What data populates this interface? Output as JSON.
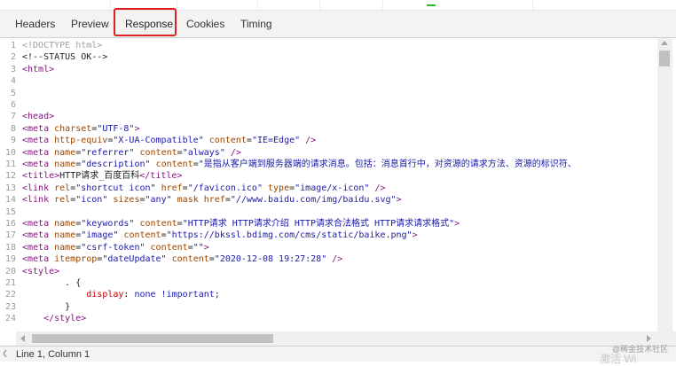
{
  "tabs": [
    {
      "label": "Headers"
    },
    {
      "label": "Preview"
    },
    {
      "label": "Response"
    },
    {
      "label": "Cookies"
    },
    {
      "label": "Timing"
    }
  ],
  "active_tab": "Response",
  "code_lines": [
    {
      "n": "1",
      "segs": [
        {
          "t": "<!DOCTYPE html>",
          "c": "comment"
        }
      ]
    },
    {
      "n": "2",
      "segs": [
        {
          "t": "<!--STATUS OK-->",
          "c": "text"
        }
      ]
    },
    {
      "n": "3",
      "segs": [
        {
          "t": "<html>",
          "c": "tag"
        }
      ]
    },
    {
      "n": "4",
      "segs": []
    },
    {
      "n": "5",
      "segs": []
    },
    {
      "n": "6",
      "segs": []
    },
    {
      "n": "7",
      "segs": [
        {
          "t": "<head>",
          "c": "tag"
        }
      ]
    },
    {
      "n": "8",
      "segs": [
        {
          "t": "<meta ",
          "c": "tag"
        },
        {
          "t": "charset",
          "c": "attr"
        },
        {
          "t": "=",
          "c": "text"
        },
        {
          "t": "\"UTF-8\"",
          "c": "val"
        },
        {
          "t": ">",
          "c": "tag"
        }
      ]
    },
    {
      "n": "9",
      "segs": [
        {
          "t": "<meta ",
          "c": "tag"
        },
        {
          "t": "http-equiv",
          "c": "attr"
        },
        {
          "t": "=",
          "c": "text"
        },
        {
          "t": "\"X-UA-Compatible\"",
          "c": "val"
        },
        {
          "t": " ",
          "c": "text"
        },
        {
          "t": "content",
          "c": "attr"
        },
        {
          "t": "=",
          "c": "text"
        },
        {
          "t": "\"IE=Edge\"",
          "c": "val"
        },
        {
          "t": " />",
          "c": "tag"
        }
      ]
    },
    {
      "n": "10",
      "segs": [
        {
          "t": "<meta ",
          "c": "tag"
        },
        {
          "t": "name",
          "c": "attr"
        },
        {
          "t": "=",
          "c": "text"
        },
        {
          "t": "\"referrer\"",
          "c": "val"
        },
        {
          "t": " ",
          "c": "text"
        },
        {
          "t": "content",
          "c": "attr"
        },
        {
          "t": "=",
          "c": "text"
        },
        {
          "t": "\"always\"",
          "c": "val"
        },
        {
          "t": " />",
          "c": "tag"
        }
      ]
    },
    {
      "n": "11",
      "segs": [
        {
          "t": "<meta ",
          "c": "tag"
        },
        {
          "t": "name",
          "c": "attr"
        },
        {
          "t": "=",
          "c": "text"
        },
        {
          "t": "\"description\"",
          "c": "val"
        },
        {
          "t": " ",
          "c": "text"
        },
        {
          "t": "content",
          "c": "attr"
        },
        {
          "t": "=",
          "c": "text"
        },
        {
          "t": "\"是指从客户端到服务器端的请求消息。包括：消息首行中，对资源的请求方法、资源的标识符、",
          "c": "val"
        }
      ]
    },
    {
      "n": "12",
      "segs": [
        {
          "t": "<title>",
          "c": "tag"
        },
        {
          "t": "HTTP请求_百度百科",
          "c": "text"
        },
        {
          "t": "</title>",
          "c": "tag"
        }
      ]
    },
    {
      "n": "13",
      "segs": [
        {
          "t": "<link ",
          "c": "tag"
        },
        {
          "t": "rel",
          "c": "attr"
        },
        {
          "t": "=",
          "c": "text"
        },
        {
          "t": "\"shortcut icon\"",
          "c": "val"
        },
        {
          "t": " ",
          "c": "text"
        },
        {
          "t": "href",
          "c": "attr"
        },
        {
          "t": "=",
          "c": "text"
        },
        {
          "t": "\"/favicon.ico\"",
          "c": "val"
        },
        {
          "t": " ",
          "c": "text"
        },
        {
          "t": "type",
          "c": "attr"
        },
        {
          "t": "=",
          "c": "text"
        },
        {
          "t": "\"image/x-icon\"",
          "c": "val"
        },
        {
          "t": " />",
          "c": "tag"
        }
      ]
    },
    {
      "n": "14",
      "segs": [
        {
          "t": "<link ",
          "c": "tag"
        },
        {
          "t": "rel",
          "c": "attr"
        },
        {
          "t": "=",
          "c": "text"
        },
        {
          "t": "\"icon\"",
          "c": "val"
        },
        {
          "t": " ",
          "c": "text"
        },
        {
          "t": "sizes",
          "c": "attr"
        },
        {
          "t": "=",
          "c": "text"
        },
        {
          "t": "\"any\"",
          "c": "val"
        },
        {
          "t": " ",
          "c": "text"
        },
        {
          "t": "mask",
          "c": "attr"
        },
        {
          "t": " ",
          "c": "text"
        },
        {
          "t": "href",
          "c": "attr"
        },
        {
          "t": "=",
          "c": "text"
        },
        {
          "t": "\"//www.baidu.com/img/baidu.svg\"",
          "c": "val"
        },
        {
          "t": ">",
          "c": "tag"
        }
      ]
    },
    {
      "n": "15",
      "segs": []
    },
    {
      "n": "16",
      "segs": [
        {
          "t": "<meta ",
          "c": "tag"
        },
        {
          "t": "name",
          "c": "attr"
        },
        {
          "t": "=",
          "c": "text"
        },
        {
          "t": "\"keywords\"",
          "c": "val"
        },
        {
          "t": " ",
          "c": "text"
        },
        {
          "t": "content",
          "c": "attr"
        },
        {
          "t": "=",
          "c": "text"
        },
        {
          "t": "\"HTTP请求 HTTP请求介绍 HTTP请求合法格式 HTTP请求请求格式\"",
          "c": "val"
        },
        {
          "t": ">",
          "c": "tag"
        }
      ]
    },
    {
      "n": "17",
      "segs": [
        {
          "t": "<meta ",
          "c": "tag"
        },
        {
          "t": "name",
          "c": "attr"
        },
        {
          "t": "=",
          "c": "text"
        },
        {
          "t": "\"image\"",
          "c": "val"
        },
        {
          "t": " ",
          "c": "text"
        },
        {
          "t": "content",
          "c": "attr"
        },
        {
          "t": "=",
          "c": "text"
        },
        {
          "t": "\"https://bkssl.bdimg.com/cms/static/baike.png\"",
          "c": "val"
        },
        {
          "t": ">",
          "c": "tag"
        }
      ]
    },
    {
      "n": "18",
      "segs": [
        {
          "t": "<meta ",
          "c": "tag"
        },
        {
          "t": "name",
          "c": "attr"
        },
        {
          "t": "=",
          "c": "text"
        },
        {
          "t": "\"csrf-token\"",
          "c": "val"
        },
        {
          "t": " ",
          "c": "text"
        },
        {
          "t": "content",
          "c": "attr"
        },
        {
          "t": "=",
          "c": "text"
        },
        {
          "t": "\"\"",
          "c": "val"
        },
        {
          "t": ">",
          "c": "tag"
        }
      ]
    },
    {
      "n": "19",
      "segs": [
        {
          "t": "<meta ",
          "c": "tag"
        },
        {
          "t": "itemprop",
          "c": "attr"
        },
        {
          "t": "=",
          "c": "text"
        },
        {
          "t": "\"dateUpdate\"",
          "c": "val"
        },
        {
          "t": " ",
          "c": "text"
        },
        {
          "t": "content",
          "c": "attr"
        },
        {
          "t": "=",
          "c": "text"
        },
        {
          "t": "\"2020-12-08 19:27:28\"",
          "c": "val"
        },
        {
          "t": " />",
          "c": "tag"
        }
      ]
    },
    {
      "n": "20",
      "segs": [
        {
          "t": "<style>",
          "c": "tag"
        }
      ]
    },
    {
      "n": "21",
      "segs": [
        {
          "t": "        . {",
          "c": "text"
        }
      ]
    },
    {
      "n": "22",
      "segs": [
        {
          "t": "            ",
          "c": "text"
        },
        {
          "t": "display",
          "c": "prop"
        },
        {
          "t": ": ",
          "c": "text"
        },
        {
          "t": "none !important",
          "c": "val"
        },
        {
          "t": ";",
          "c": "text"
        }
      ]
    },
    {
      "n": "23",
      "segs": [
        {
          "t": "        }",
          "c": "text"
        }
      ]
    },
    {
      "n": "24",
      "segs": [
        {
          "t": "    </style>",
          "c": "tag"
        }
      ]
    }
  ],
  "status_bar": {
    "text": "Line 1, Column 1"
  },
  "watermark": {
    "text": "@稀金技术社区",
    "faded": "激活 Wi"
  },
  "colors": {
    "tab_underline": "#3e7ae0",
    "highlight_box": "#e02020",
    "tag": "#881280",
    "attr": "#994500",
    "value": "#1a1aa6",
    "comment": "#a0a0a0"
  }
}
